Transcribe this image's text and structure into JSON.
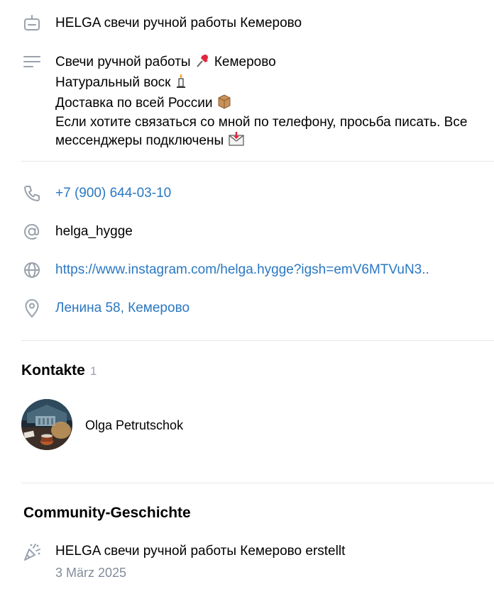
{
  "profile": {
    "name": "HELGA свечи ручной работы Кемерово",
    "about_lines": [
      "Свечи ручной работы",
      "Кемерово",
      "Натуральный воск",
      "Доставка по всей России",
      "Если хотите связаться со мной по телефону, просьба писать. Все",
      "мессенджеры подключены"
    ],
    "icons": {
      "name": "id-card-icon",
      "about": "text-lines-icon",
      "pushpin": "pushpin-emoji",
      "candle": "candle-emoji",
      "package": "package-emoji",
      "envelope": "envelope-with-arrow-emoji"
    }
  },
  "contacts_info": {
    "phone": "+7 (900) 644-03-10",
    "username": "helga_hygge",
    "website": "https://www.instagram.com/helga.hygge?igsh=emV6MTVuN3..",
    "address": "Ленина 58, Кемерово",
    "icons": {
      "phone": "phone-icon",
      "username": "at-sign-icon",
      "website": "globe-icon",
      "address": "location-pin-icon"
    }
  },
  "kontakte": {
    "title": "Kontakte",
    "count": "1",
    "items": [
      {
        "name": "Olga Petrutschok"
      }
    ]
  },
  "history": {
    "title": "Community-Geschichte",
    "event": "HELGA свечи ручной работы Кемерово erstellt",
    "date": "3 März 2025",
    "icon": "party-popper-icon"
  },
  "colors": {
    "link": "#2a78c2",
    "icon_gray": "#99a2ad",
    "divider": "#e6e8eb",
    "secondary_text": "#818c99"
  }
}
